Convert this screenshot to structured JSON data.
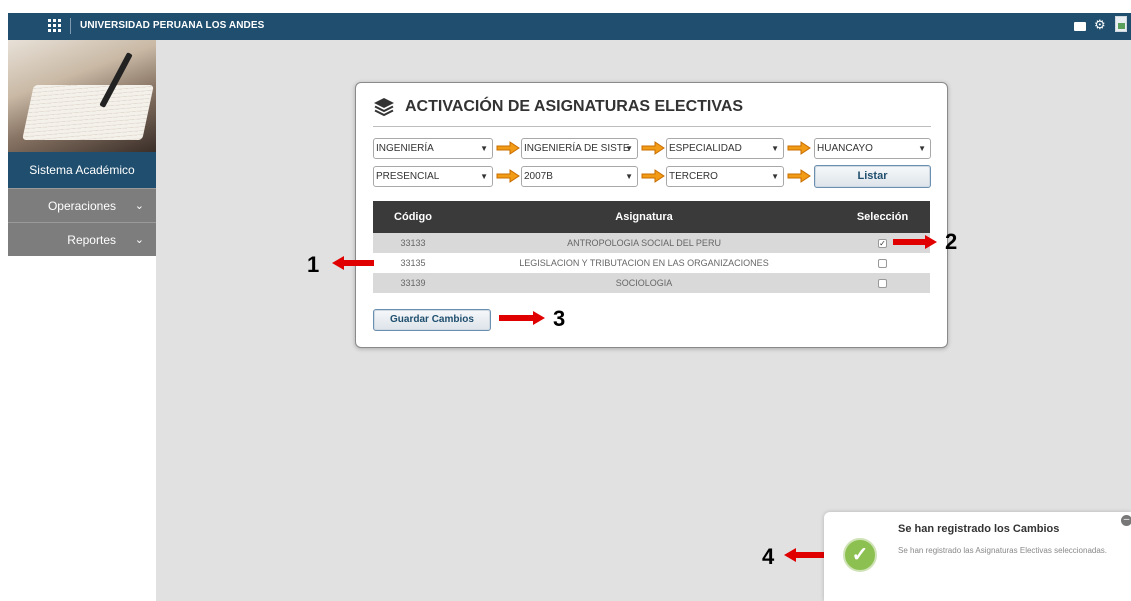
{
  "header": {
    "app_title": "UNIVERSIDAD PERUANA LOS ANDES",
    "icons": [
      "apps-grid-icon",
      "chat-icon",
      "gear-icon",
      "broken-image-icon"
    ],
    "bar_color": "#1f4e6e"
  },
  "sidebar": {
    "system_title": "Sistema Académico",
    "items": [
      {
        "label": "Operaciones",
        "icon": "chevron-down-icon"
      },
      {
        "label": "Reportes",
        "icon": "chevron-down-icon"
      }
    ]
  },
  "panel": {
    "title": "ACTIVACIÓN DE ASIGNATURAS ELECTIVAS",
    "filters_row1": [
      "INGENIERÍA",
      "INGENIERÍA DE SISTE",
      "ESPECIALIDAD",
      "HUANCAYO"
    ],
    "filters_row2": [
      "PRESENCIAL",
      "2007B",
      "TERCERO"
    ],
    "listar_label": "Listar",
    "table": {
      "headers": [
        "Código",
        "Asignatura",
        "Selección"
      ],
      "rows": [
        {
          "codigo": "33133",
          "asignatura": "ANTROPOLOGIA SOCIAL DEL PERU",
          "checked": true
        },
        {
          "codigo": "33135",
          "asignatura": "LEGISLACION Y TRIBUTACION EN LAS ORGANIZACIONES",
          "checked": false
        },
        {
          "codigo": "33139",
          "asignatura": "SOCIOLOGIA",
          "checked": false
        }
      ]
    },
    "save_label": "Guardar Cambios"
  },
  "annotations": {
    "n1": "1",
    "n2": "2",
    "n3": "3",
    "n4": "4",
    "color": "#e00000"
  },
  "toast": {
    "title": "Se han registrado los Cambios",
    "message": "Se han registrado las Asignaturas Electivas seleccionadas.",
    "icon": "checkmark-icon",
    "icon_color": "#8cc152"
  }
}
